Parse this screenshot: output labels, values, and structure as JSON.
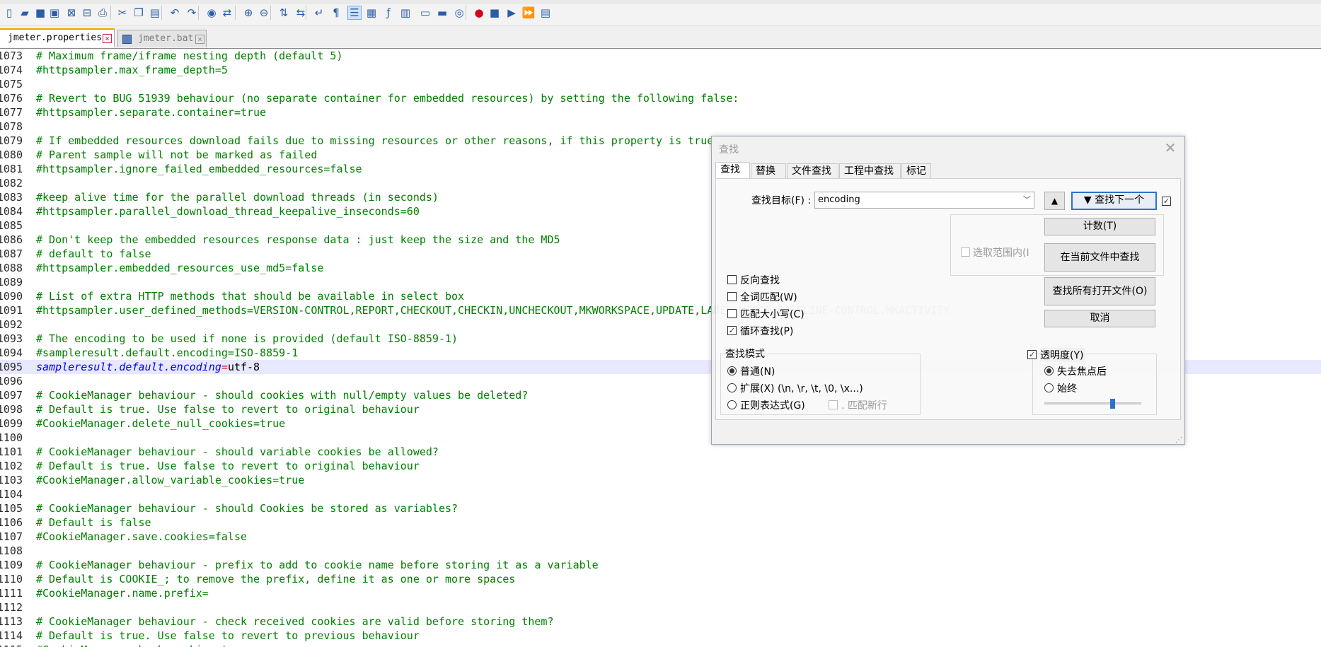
{
  "toolbar": {
    "icons": [
      "new-file-icon",
      "open-file-icon",
      "save-icon",
      "save-all-icon",
      "close-icon",
      "close-all-icon",
      "print-icon",
      "cut-icon",
      "copy-icon",
      "paste-icon",
      "undo-icon",
      "redo-icon",
      "find-icon",
      "replace-icon",
      "zoom-in-icon",
      "zoom-out-icon",
      "sync-vertical-icon",
      "sync-horizontal-icon",
      "word-wrap-icon",
      "show-all-chars-icon",
      "indent-guide-icon",
      "document-map-icon",
      "function-list-icon",
      "clipboard-icon",
      "folder-workspace-icon",
      "monitor-icon",
      "eye-icon",
      "record-macro-icon",
      "stop-macro-icon",
      "play-macro-icon",
      "run-macro-multiple-icon",
      "save-macro-icon"
    ]
  },
  "tabs": [
    {
      "label": "jmeter.properties",
      "active": true
    },
    {
      "label": "jmeter.bat",
      "active": false
    }
  ],
  "editor": {
    "lines": [
      {
        "num": "1073",
        "text": "# Maximum frame/iframe nesting depth (default 5)"
      },
      {
        "num": "1074",
        "text": "#httpsampler.max_frame_depth=5"
      },
      {
        "num": "1075",
        "text": ""
      },
      {
        "num": "1076",
        "text": "# Revert to BUG 51939 behaviour (no separate container for embedded resources) by setting the following false:"
      },
      {
        "num": "1077",
        "text": "#httpsampler.separate.container=true"
      },
      {
        "num": "1078",
        "text": ""
      },
      {
        "num": "1079",
        "text": "# If embedded resources download fails due to missing resources or other reasons, if this property is true"
      },
      {
        "num": "1080",
        "text": "# Parent sample will not be marked as failed"
      },
      {
        "num": "1081",
        "text": "#httpsampler.ignore_failed_embedded_resources=false"
      },
      {
        "num": "1082",
        "text": ""
      },
      {
        "num": "1083",
        "text": "#keep alive time for the parallel download threads (in seconds)"
      },
      {
        "num": "1084",
        "text": "#httpsampler.parallel_download_thread_keepalive_inseconds=60"
      },
      {
        "num": "1085",
        "text": ""
      },
      {
        "num": "1086",
        "text": "# Don't keep the embedded resources response data : just keep the size and the MD5"
      },
      {
        "num": "1087",
        "text": "# default to false"
      },
      {
        "num": "1088",
        "text": "#httpsampler.embedded_resources_use_md5=false"
      },
      {
        "num": "1089",
        "text": ""
      },
      {
        "num": "1090",
        "text": "# List of extra HTTP methods that should be available in select box"
      },
      {
        "num": "1091",
        "text": "#httpsampler.user_defined_methods=VERSION-CONTROL,REPORT,CHECKOUT,CHECKIN,UNCHECKOUT,MKWORKSPACE,UPDATE,LABEL,MERGE,BASELINE-CONTROL,MKACTIVITY"
      },
      {
        "num": "1092",
        "text": ""
      },
      {
        "num": "1093",
        "text": "# The encoding to be used if none is provided (default ISO-8859-1)"
      },
      {
        "num": "1094",
        "text": "#sampleresult.default.encoding=ISO-8859-1"
      },
      {
        "num": "1095",
        "text": "",
        "key": "sampleresult.default.encoding",
        "eq": "=",
        "value": "utf-8",
        "current": true
      },
      {
        "num": "1096",
        "text": ""
      },
      {
        "num": "1097",
        "text": "# CookieManager behaviour - should cookies with null/empty values be deleted?"
      },
      {
        "num": "1098",
        "text": "# Default is true. Use false to revert to original behaviour"
      },
      {
        "num": "1099",
        "text": "#CookieManager.delete_null_cookies=true"
      },
      {
        "num": "1100",
        "text": ""
      },
      {
        "num": "1101",
        "text": "# CookieManager behaviour - should variable cookies be allowed?"
      },
      {
        "num": "1102",
        "text": "# Default is true. Use false to revert to original behaviour"
      },
      {
        "num": "1103",
        "text": "#CookieManager.allow_variable_cookies=true"
      },
      {
        "num": "1104",
        "text": ""
      },
      {
        "num": "1105",
        "text": "# CookieManager behaviour - should Cookies be stored as variables?"
      },
      {
        "num": "1106",
        "text": "# Default is false"
      },
      {
        "num": "1107",
        "text": "#CookieManager.save.cookies=false"
      },
      {
        "num": "1108",
        "text": ""
      },
      {
        "num": "1109",
        "text": "# CookieManager behaviour - prefix to add to cookie name before storing it as a variable"
      },
      {
        "num": "1110",
        "text": "# Default is COOKIE_; to remove the prefix, define it as one or more spaces"
      },
      {
        "num": "1111",
        "text": "#CookieManager.name.prefix="
      },
      {
        "num": "1112",
        "text": ""
      },
      {
        "num": "1113",
        "text": "# CookieManager behaviour - check received cookies are valid before storing them?"
      },
      {
        "num": "1114",
        "text": "# Default is true. Use false to revert to previous behaviour"
      },
      {
        "num": "1115",
        "text": "#CookieManager.check.cookies=true"
      }
    ]
  },
  "find_dialog": {
    "title": "查找",
    "tabs": [
      "查找",
      "替换",
      "文件查找",
      "工程中查找",
      "标记"
    ],
    "target_label": "查找目标(F) :",
    "target_value": "encoding",
    "up_button": "▲",
    "find_next_button": "▼ 查找下一个",
    "count_button": "计数(T)",
    "find_in_current_button": "在当前文件中查找",
    "find_in_all_open_button": "查找所有打开文件(O)",
    "cancel_button": "取消",
    "in_selection_label": "选取范围内(I",
    "options": [
      {
        "label": "反向查找",
        "checked": false
      },
      {
        "label": "全词匹配(W)",
        "checked": false
      },
      {
        "label": "匹配大小写(C)",
        "checked": false
      },
      {
        "label": "循环查找(P)",
        "checked": true
      }
    ],
    "search_mode_title": "查找模式",
    "search_modes": [
      {
        "label": "普通(N)",
        "selected": true
      },
      {
        "label": "扩展(X) (\\n, \\r, \\t, \\0, \\x...)",
        "selected": false
      },
      {
        "label": "正则表达式(G)",
        "selected": false
      }
    ],
    "dot_newline_label": ". 匹配新行",
    "transparency_label": "透明度(Y)",
    "transparency_checked": true,
    "transparency_modes": [
      {
        "label": "失去焦点后",
        "selected": true
      },
      {
        "label": "始终",
        "selected": false
      }
    ],
    "transparency_level": 0.7
  }
}
